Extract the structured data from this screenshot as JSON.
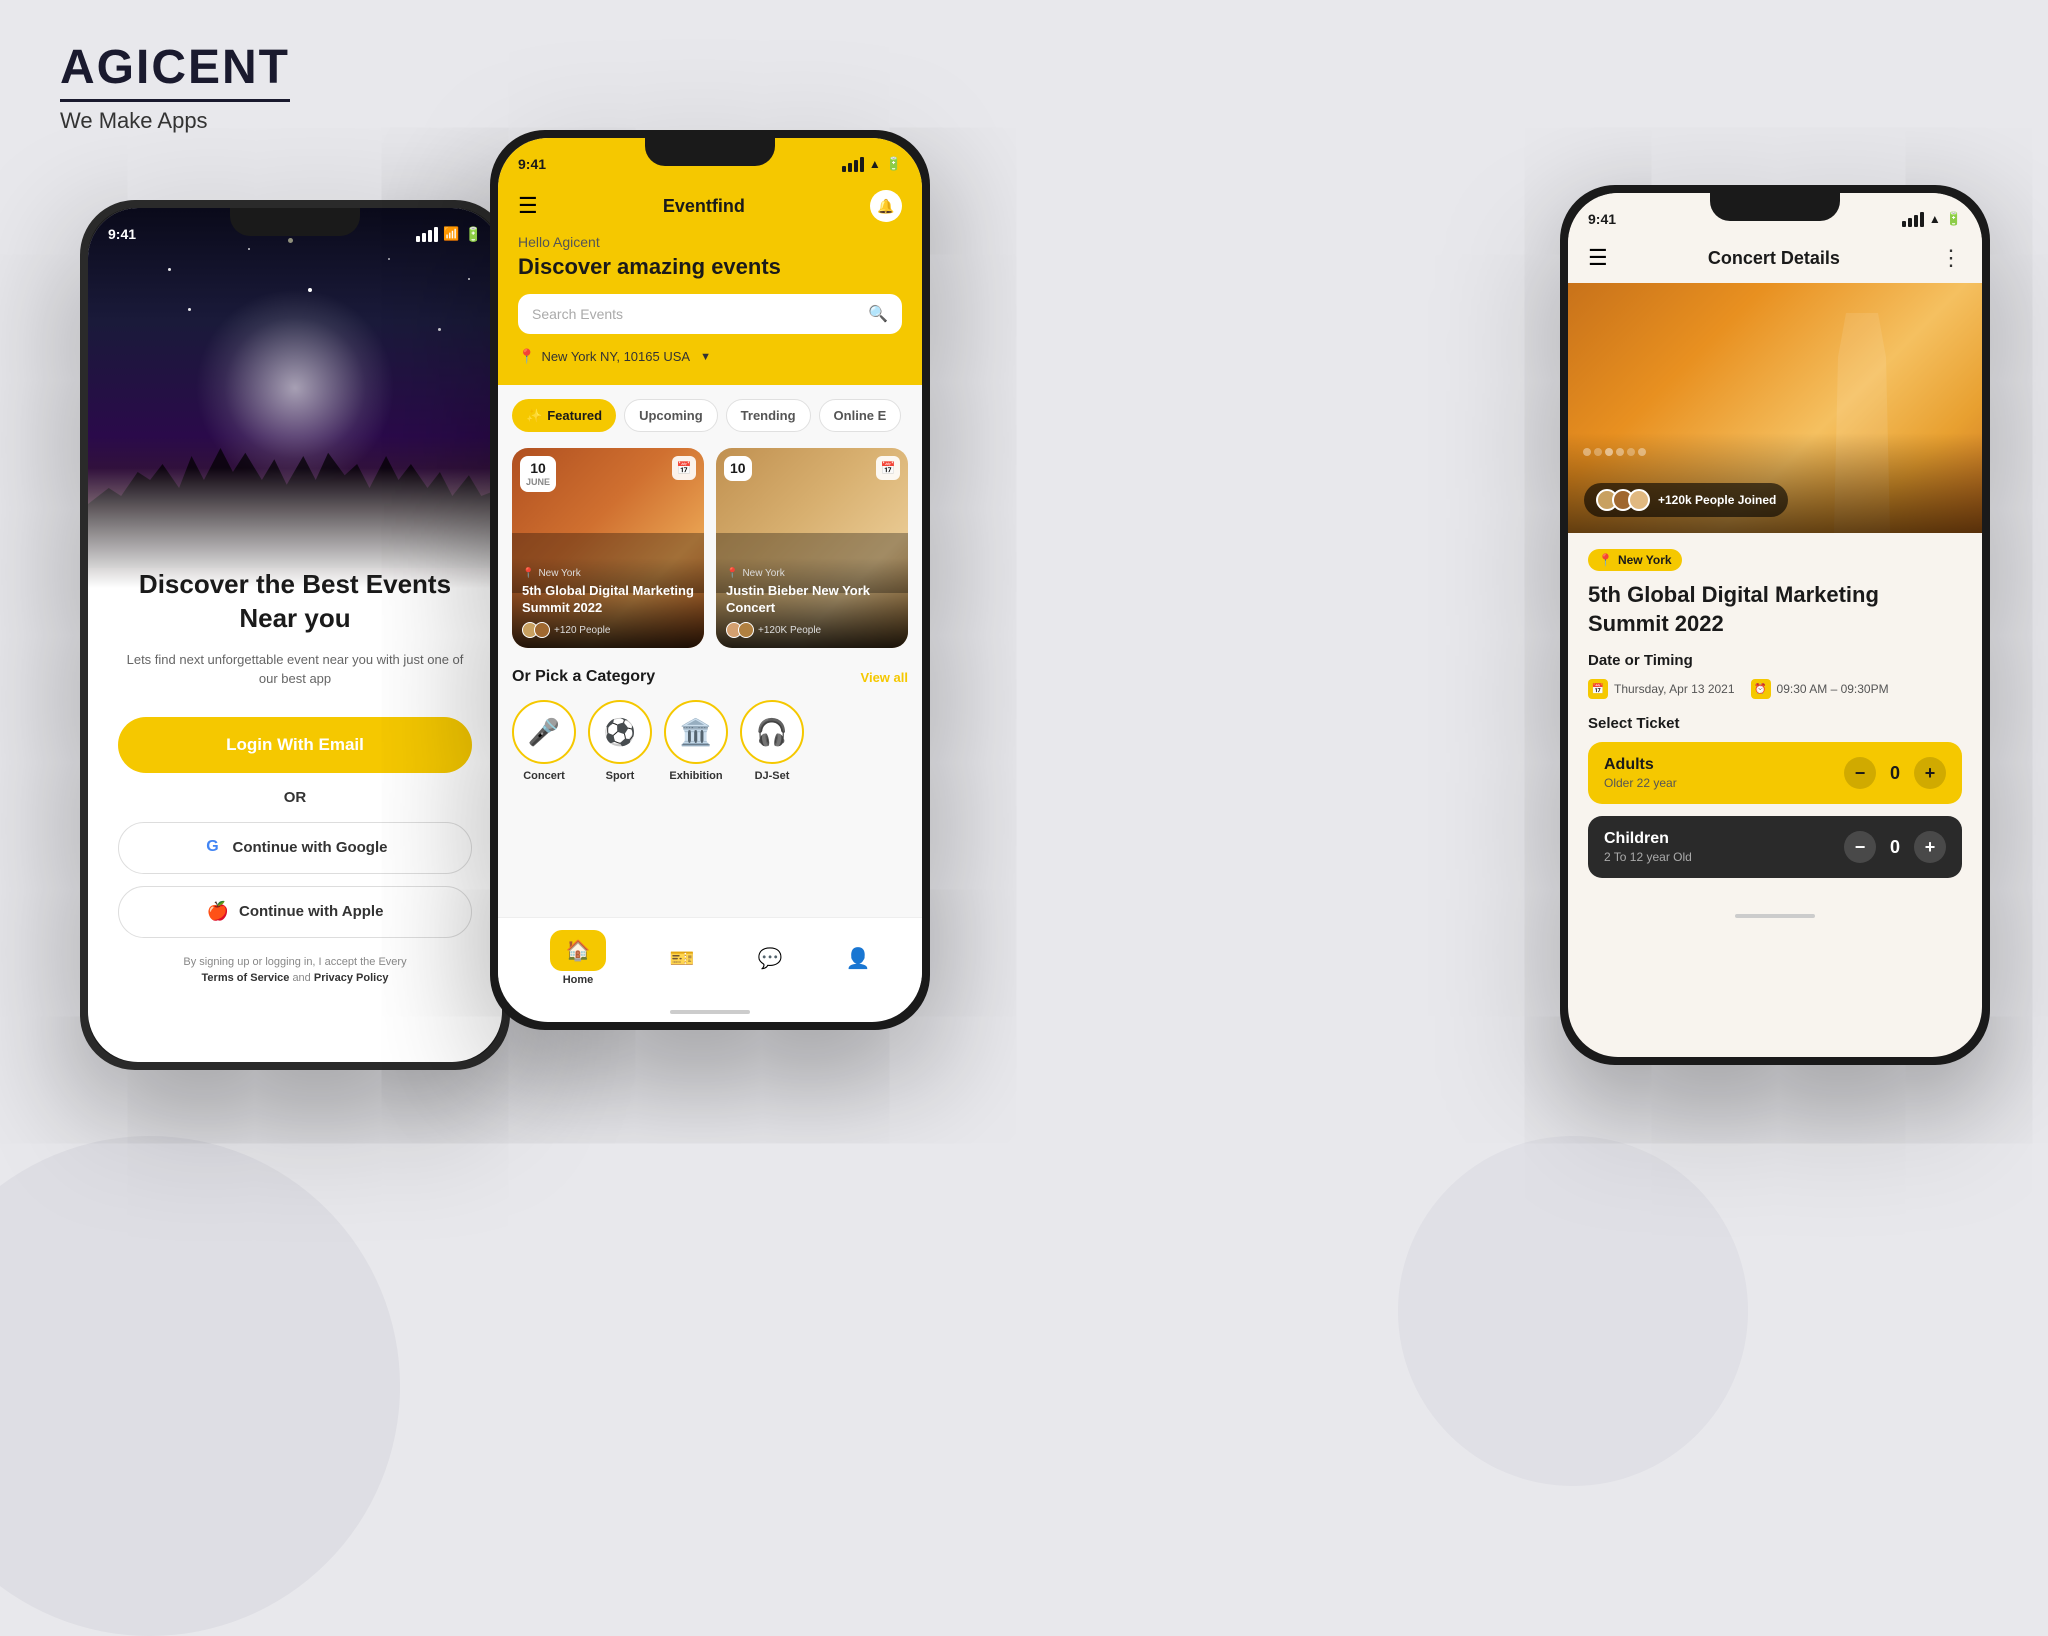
{
  "brand": {
    "name": "AGICENT",
    "tagline": "We Make Apps"
  },
  "phone1": {
    "status_time": "9:41",
    "title": "Discover the Best Events Near you",
    "subtitle": "Lets find next unforgettable event near you with just one of our best app",
    "login_btn": "Login With Email",
    "or_text": "OR",
    "google_btn": "Continue with Google",
    "apple_btn": "Continue with Apple",
    "terms_text": "By signing up or logging in, I accept the Every",
    "terms_link1": "Terms of Service",
    "and_text": "and",
    "terms_link2": "Privacy Policy"
  },
  "phone2": {
    "status_time": "9:41",
    "app_title": "Eventfind",
    "greeting": "Hello Agicent",
    "discover_title": "Discover amazing events",
    "search_placeholder": "Search Events",
    "location": "New York NY, 10165 USA",
    "tabs": [
      {
        "label": "Featured",
        "active": true
      },
      {
        "label": "Upcoming",
        "active": false
      },
      {
        "label": "Trending",
        "active": false
      },
      {
        "label": "Online E",
        "active": false
      }
    ],
    "events": [
      {
        "day": "10",
        "month": "JUNE",
        "location": "New York",
        "title": "5th Global Digital Marketing Summit 2022",
        "attendees": "+120 People"
      },
      {
        "day": "10",
        "month": "",
        "location": "New York",
        "title": "Justin Bieber New York Concert",
        "attendees": "+120K People"
      }
    ],
    "category_title": "Or Pick a Category",
    "view_all": "View all",
    "categories": [
      {
        "icon": "🎤",
        "label": "Concert"
      },
      {
        "icon": "⚽",
        "label": "Sport"
      },
      {
        "icon": "🏛️",
        "label": "Exhibition"
      },
      {
        "icon": "🎧",
        "label": "DJ-Set"
      }
    ],
    "nav": [
      {
        "icon": "🏠",
        "label": "Home",
        "active": true
      },
      {
        "icon": "🎫",
        "label": "",
        "active": false
      },
      {
        "icon": "💬",
        "label": "",
        "active": false
      },
      {
        "icon": "👤",
        "label": "",
        "active": false
      }
    ]
  },
  "phone3": {
    "status_time": "9:41",
    "header_title": "Concert Details",
    "location_tag": "New York",
    "event_title": "5th Global Digital Marketing Summit 2022",
    "people_joined": "+120k People Joined",
    "date_timing_label": "Date or Timing",
    "date_value": "Thursday, Apr 13 2021",
    "time_value": "09:30 AM – 09:30PM",
    "select_ticket_label": "Select Ticket",
    "adults_label": "Adults",
    "adults_desc": "Older 22 year",
    "adults_count": "0",
    "children_label": "Children",
    "children_desc": "2 To 12 year Old",
    "children_count": "0"
  }
}
